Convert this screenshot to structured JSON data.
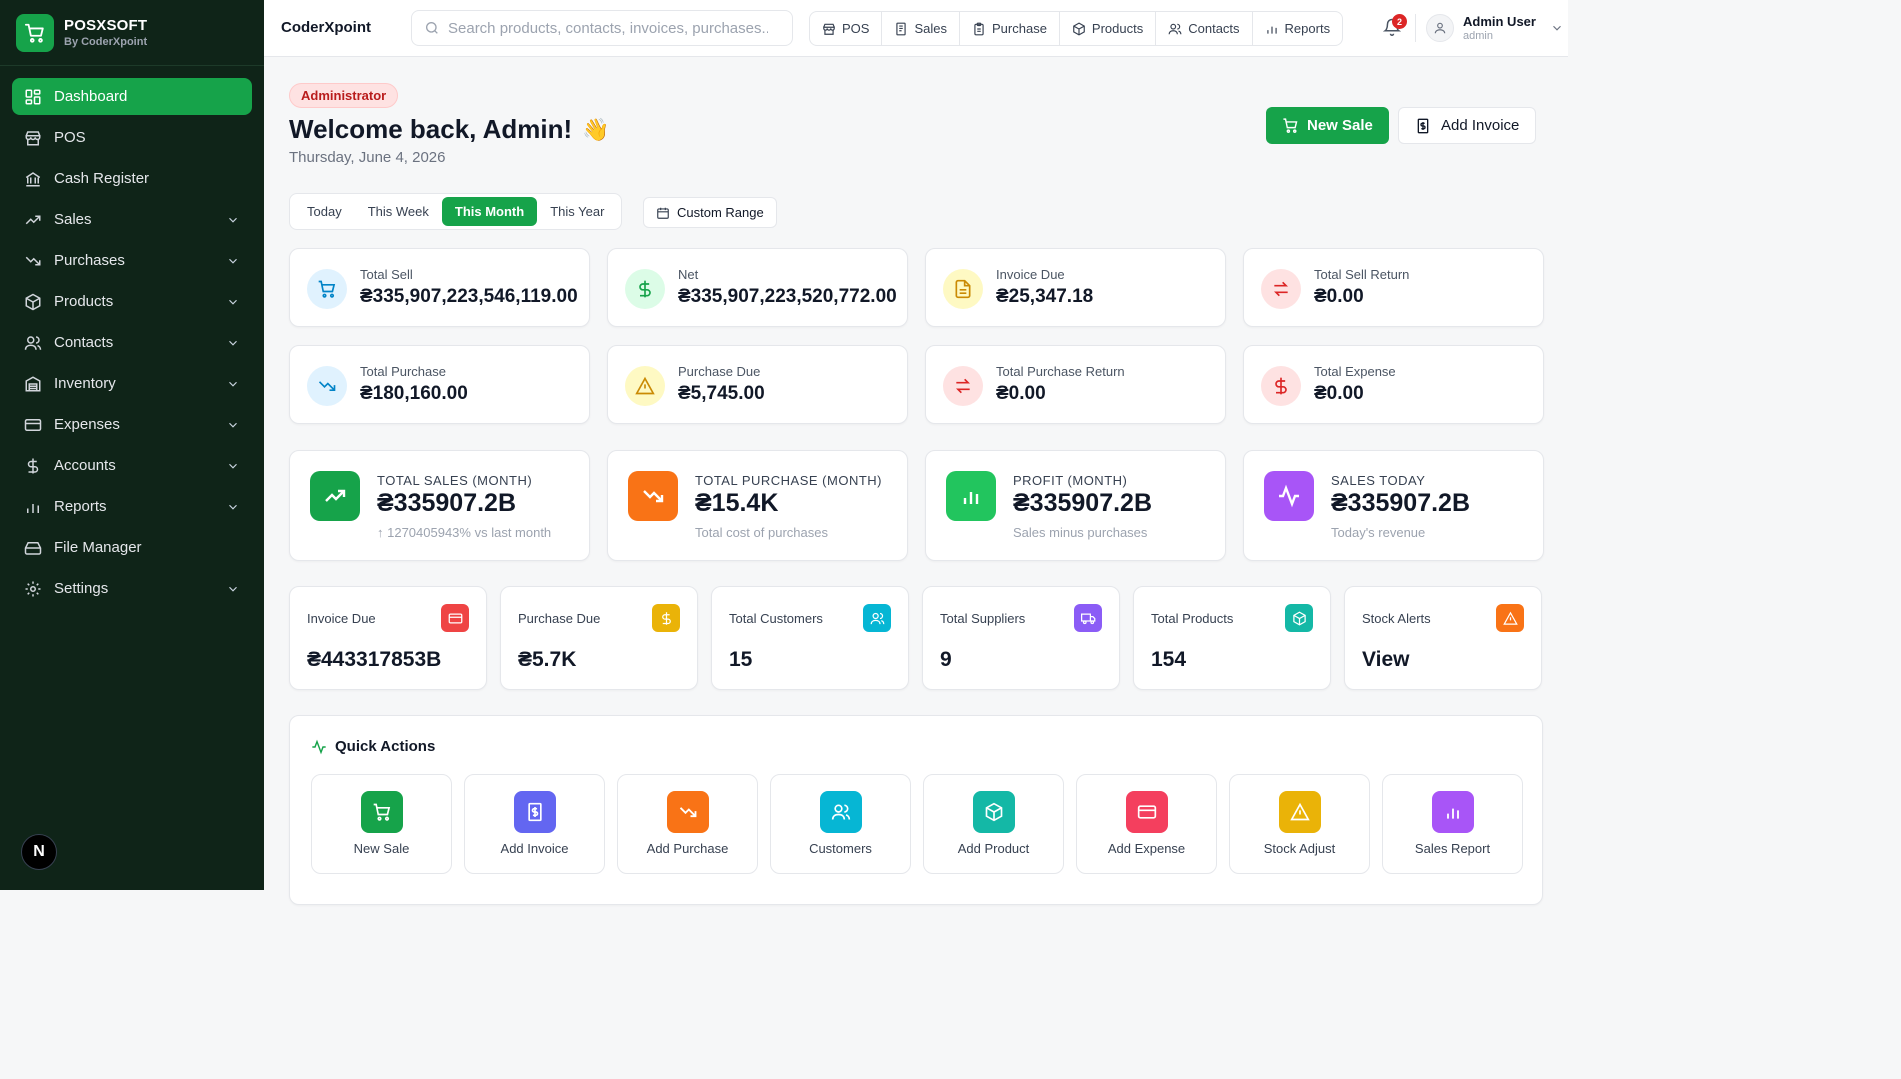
{
  "brand": {
    "name": "POSXSOFT",
    "sub": "By CoderXpoint"
  },
  "sidebar": {
    "items": [
      {
        "label": "Dashboard"
      },
      {
        "label": "POS"
      },
      {
        "label": "Cash Register"
      },
      {
        "label": "Sales"
      },
      {
        "label": "Purchases"
      },
      {
        "label": "Products"
      },
      {
        "label": "Contacts"
      },
      {
        "label": "Inventory"
      },
      {
        "label": "Expenses"
      },
      {
        "label": "Accounts"
      },
      {
        "label": "Reports"
      },
      {
        "label": "File Manager"
      },
      {
        "label": "Settings"
      }
    ],
    "badge": "N"
  },
  "topbar": {
    "title": "CoderXpoint",
    "search_placeholder": "Search products, contacts, invoices, purchases...",
    "quicknav": [
      "POS",
      "Sales",
      "Purchase",
      "Products",
      "Contacts",
      "Reports"
    ],
    "notifications": "2",
    "user_name": "Admin User",
    "user_role": "admin"
  },
  "header": {
    "role": "Administrator",
    "welcome": "Welcome back, Admin!",
    "wave": "👋",
    "date": "Thursday, June 4, 2026",
    "new_sale": "New Sale",
    "add_invoice": "Add Invoice"
  },
  "ranges": [
    "Today",
    "This Week",
    "This Month",
    "This Year"
  ],
  "custom_range": "Custom Range",
  "stats": [
    {
      "label": "Total Sell",
      "value": "₴335,907,223,546,119.00"
    },
    {
      "label": "Net",
      "value": "₴335,907,223,520,772.00"
    },
    {
      "label": "Invoice Due",
      "value": "₴25,347.18"
    },
    {
      "label": "Total Sell Return",
      "value": "₴0.00"
    },
    {
      "label": "Total Purchase",
      "value": "₴180,160.00"
    },
    {
      "label": "Purchase Due",
      "value": "₴5,745.00"
    },
    {
      "label": "Total Purchase Return",
      "value": "₴0.00"
    },
    {
      "label": "Total Expense",
      "value": "₴0.00"
    }
  ],
  "big": [
    {
      "label": "TOTAL SALES (MONTH)",
      "value": "₴335907.2B",
      "sub": "↑ 1270405943% vs last month"
    },
    {
      "label": "TOTAL PURCHASE (MONTH)",
      "value": "₴15.4K",
      "sub": "Total cost of purchases"
    },
    {
      "label": "PROFIT (MONTH)",
      "value": "₴335907.2B",
      "sub": "Sales minus purchases"
    },
    {
      "label": "SALES TODAY",
      "value": "₴335907.2B",
      "sub": "Today's revenue"
    }
  ],
  "mini": [
    {
      "label": "Invoice Due",
      "value": "₴443317853B"
    },
    {
      "label": "Purchase Due",
      "value": "₴5.7K"
    },
    {
      "label": "Total Customers",
      "value": "15"
    },
    {
      "label": "Total Suppliers",
      "value": "9"
    },
    {
      "label": "Total Products",
      "value": "154"
    },
    {
      "label": "Stock Alerts",
      "value": "View"
    }
  ],
  "quick_actions": {
    "title": "Quick Actions",
    "items": [
      "New Sale",
      "Add Invoice",
      "Add Purchase",
      "Customers",
      "Add Product",
      "Add Expense",
      "Stock Adjust",
      "Sales Report"
    ]
  },
  "colors": {
    "brand": "#16a34a",
    "sidebar_bg": "#0f2418",
    "danger": "#dc2626"
  }
}
